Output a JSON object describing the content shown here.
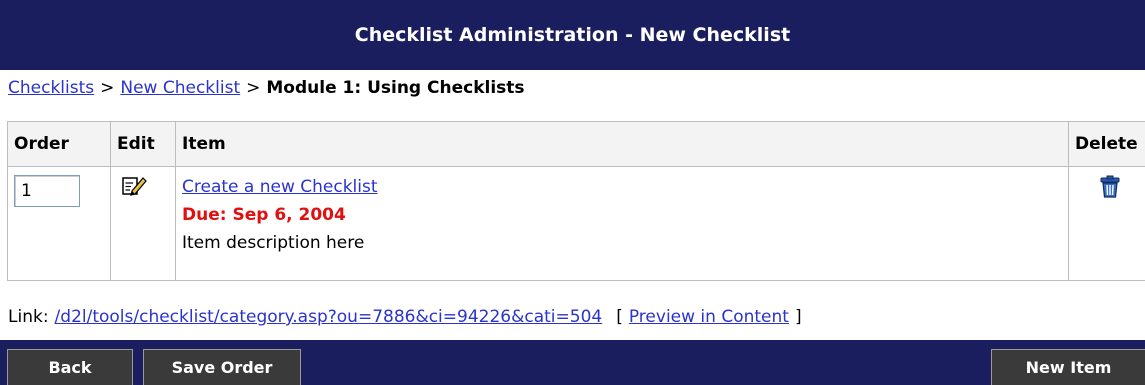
{
  "header": {
    "title": "Checklist Administration - New Checklist"
  },
  "breadcrumb": {
    "items": [
      {
        "label": "Checklists"
      },
      {
        "label": "New Checklist"
      }
    ],
    "separator": ">",
    "current": "Module 1: Using Checklists"
  },
  "table": {
    "headers": {
      "order": "Order",
      "edit": "Edit",
      "item": "Item",
      "delete": "Delete"
    },
    "rows": [
      {
        "order": "1",
        "item_title": "Create a new Checklist",
        "due": "Due: Sep 6, 2004",
        "description": "Item description here"
      }
    ]
  },
  "link_row": {
    "label": "Link:",
    "url": "/d2l/tools/checklist/category.asp?ou=7886&ci=94226&cati=504",
    "bracket_open": "[",
    "preview": "Preview in Content",
    "bracket_close": "]"
  },
  "toolbar": {
    "back": "Back",
    "save_order": "Save Order",
    "new_item": "New Item"
  },
  "icons": {
    "edit": "edit-pencil-icon",
    "delete": "trash-icon"
  },
  "colors": {
    "header_bg": "#1a1e5e",
    "link": "#2a33cc",
    "due": "#e01010",
    "button_bg": "#3a3a3a"
  }
}
